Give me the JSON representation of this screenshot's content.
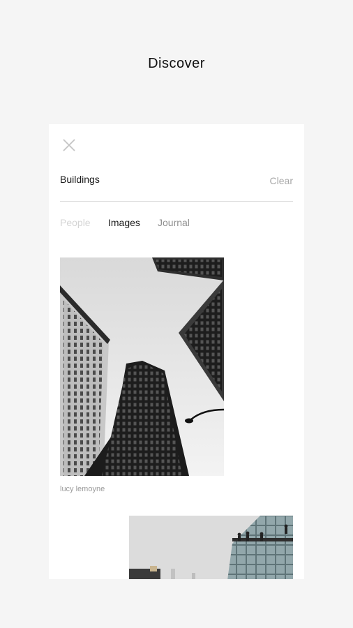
{
  "header": {
    "title": "Discover"
  },
  "search": {
    "query": "Buildings",
    "clear_label": "Clear"
  },
  "tabs": [
    {
      "label": "People",
      "state": "disabled"
    },
    {
      "label": "Images",
      "state": "selected"
    },
    {
      "label": "Journal",
      "state": "default"
    }
  ],
  "results": [
    {
      "credit": "lucy lemoyne",
      "description": "black and white upward view of buildings"
    },
    {
      "credit": "",
      "description": "glass building with people on rooftop"
    }
  ],
  "colors": {
    "background": "#f5f5f5",
    "card": "#ffffff",
    "text_primary": "#1a1a1a",
    "text_muted": "#a7a7a7"
  }
}
